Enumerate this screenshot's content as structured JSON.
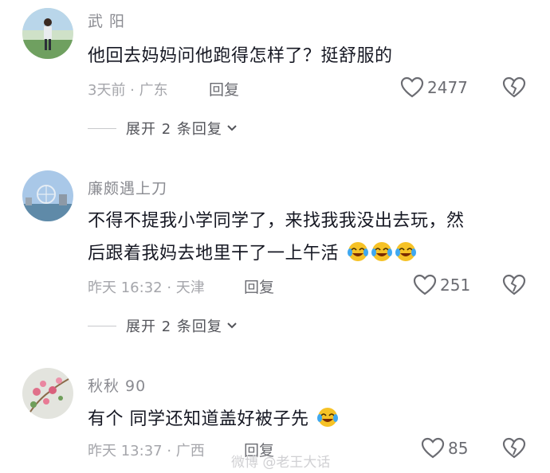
{
  "comments": [
    {
      "username": "武 阳",
      "lines": [
        "他回去妈妈问他跑得怎样了？挺舒服的"
      ],
      "meta": "3天前 · 广东",
      "reply_label": "回复",
      "likes": "2477",
      "expand_label": "展开 2 条回复"
    },
    {
      "username": "廉颇遇上刀",
      "lines": [
        "不得不提我小学同学了，来找我我没出去玩，然",
        "后跟着我妈去地里干了一上午活"
      ],
      "meta": "昨天 16:32 · 天津",
      "reply_label": "回复",
      "likes": "251",
      "expand_label": "展开 2 条回复"
    },
    {
      "username": "秋秋 90",
      "lines": [
        "有个 同学还知道盖好被子先"
      ],
      "meta": "昨天 13:37 · 广西",
      "reply_label": "回复",
      "likes": "85"
    }
  ],
  "watermark": "微博 @老王大话",
  "colors": {
    "username": "#8a8b91",
    "meta": "#a5a6ab",
    "body": "#161823"
  }
}
